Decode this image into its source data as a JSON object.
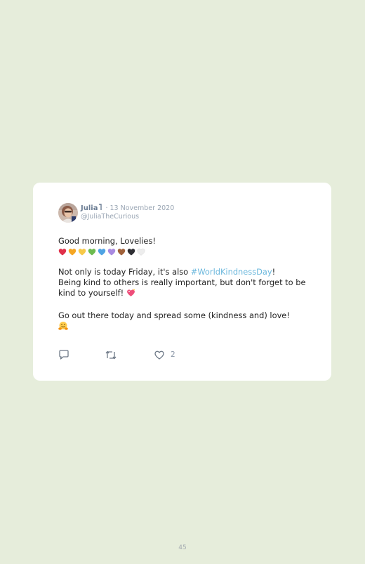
{
  "tweet": {
    "author_name": "Julia",
    "separator": " · ",
    "date": "13 November 2020",
    "handle": "@JuliaTheCurious",
    "line1": "Good morning, Lovelies!",
    "heart_colors": [
      "#e0304a",
      "#f5a623",
      "#f7c948",
      "#6dbb4f",
      "#4fa3e3",
      "#a98ae0",
      "#a0613a",
      "#2e2e33",
      "#ededed"
    ],
    "para2_before": "Not only is today Friday, it's also ",
    "hashtag": "#WorldKindnessDay",
    "para2_after": "!",
    "para3_line1": "Being kind to others is really important, but don't forget to be",
    "para3_line2": "kind to yourself!",
    "para4": "Go out there today and spread some (kindness and) love!",
    "like_count": "2"
  },
  "icons": {
    "reply": "speech-bubble-icon",
    "retweet": "retweet-icon",
    "like": "heart-outline-icon",
    "sparkle_heart": "sparkling-heart-emoji",
    "hug": "hugging-face-emoji"
  },
  "colors": {
    "background": "#e6eddb",
    "card": "#ffffff",
    "hashtag": "#6cb8dd",
    "muted": "#9aa6b4"
  },
  "page": {
    "number": "45"
  }
}
